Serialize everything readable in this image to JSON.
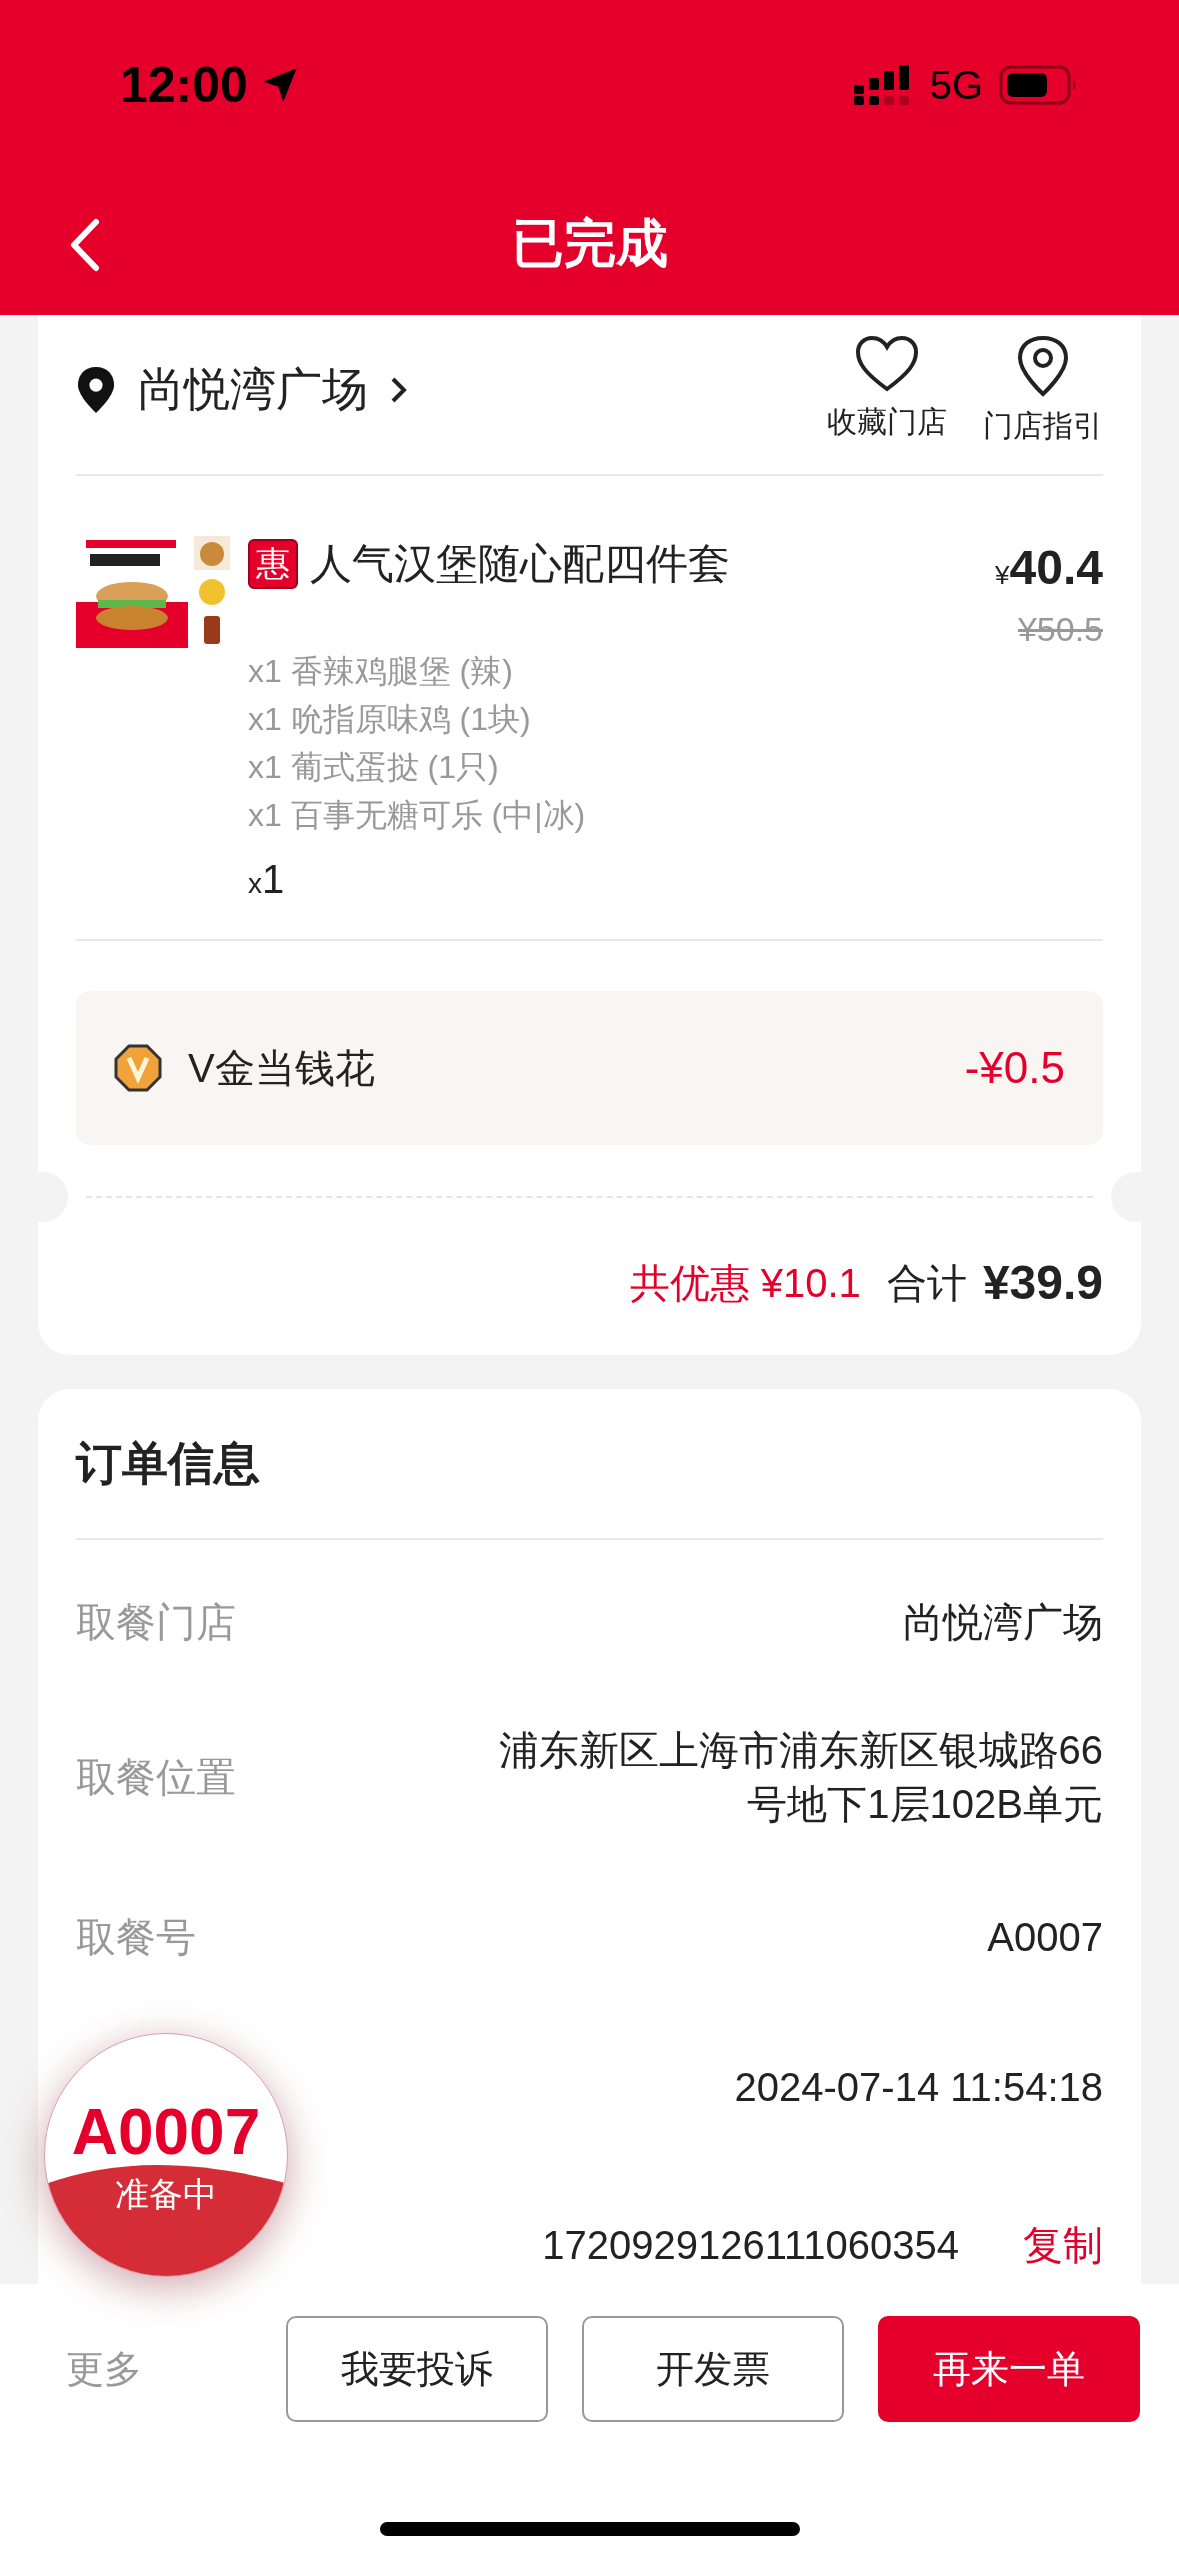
{
  "status_bar": {
    "time": "12:00",
    "network": "5G"
  },
  "nav": {
    "title": "已完成"
  },
  "store": {
    "name": "尚悦湾广场",
    "actions": [
      {
        "label": "收藏门店",
        "kind": "heart"
      },
      {
        "label": "门店指引",
        "kind": "pin"
      }
    ]
  },
  "items": [
    {
      "badge": "惠",
      "name": "人气汉堡随心配四件套",
      "price_symbol": "¥",
      "price": "40.4",
      "original_price": "¥50.5",
      "components": [
        "x1 香辣鸡腿堡 (辣)",
        "x1 吮指原味鸡 (1块)",
        "x1 葡式蛋挞 (1只)",
        "x1 百事无糖可乐 (中|冰)"
      ],
      "quantity_prefix": "x",
      "quantity": "1"
    }
  ],
  "discounts": [
    {
      "label": "V金当钱花",
      "amount": "-¥0.5"
    }
  ],
  "summary": {
    "savings": "共优惠 ¥10.1",
    "total_label": "合计",
    "total": "¥39.9"
  },
  "order_info": {
    "title": "订单信息",
    "rows": [
      {
        "label": "取餐门店",
        "value": "尚悦湾广场"
      },
      {
        "label": "取餐位置",
        "value": "浦东新区上海市浦东新区银城路66号地下1层102B单元"
      },
      {
        "label": "取餐号",
        "value": "A0007"
      },
      {
        "value": "2024-07-14 11:54:18"
      },
      {
        "value": "1720929126111060354",
        "action": "复制"
      }
    ]
  },
  "pickup_badge": {
    "number": "A0007",
    "status": "准备中"
  },
  "bottom_bar": {
    "more": "更多",
    "buttons": [
      {
        "label": "我要投诉",
        "kind": "outline"
      },
      {
        "label": "开发票",
        "kind": "outline"
      },
      {
        "label": "再来一单",
        "kind": "primary"
      }
    ]
  }
}
